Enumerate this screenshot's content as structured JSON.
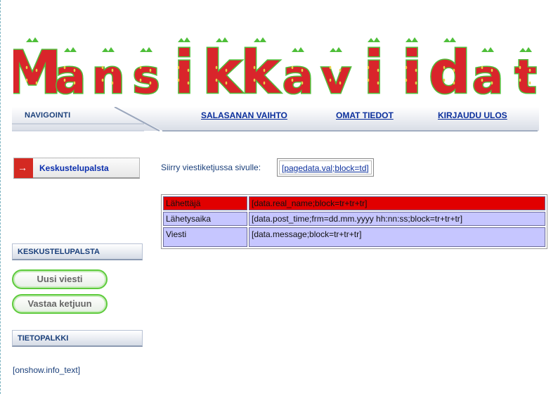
{
  "header": {
    "logo_text": "Mansikkaviidat"
  },
  "nav": {
    "title": "NAVIGOINTI",
    "links": [
      {
        "label": "SALASANAN VAIHTO"
      },
      {
        "label": "OMAT TIEDOT"
      },
      {
        "label": "KIRJAUDU ULOS"
      }
    ]
  },
  "sidebar": {
    "forum_button": "Keskustelupalsta",
    "section1_title": "KESKUSTELUPALSTA",
    "new_message_button": "Uusi viesti",
    "reply_button": "Vastaa ketjuun",
    "section2_title": "TIETOPALKKI",
    "info_text": "[onshow.info_text]"
  },
  "main": {
    "page_nav_label": "Siirry viestiketjussa sivulle:",
    "page_nav_link": "[pagedata.val;block=td]",
    "table": [
      {
        "label": "Lähettäjä",
        "value": "[data.real_name;block=tr+tr+tr]"
      },
      {
        "label": "Lähetysaika",
        "value": "[data.post_time;frm=dd.mm.yyyy hh:nn:ss;block=tr+tr+tr]"
      },
      {
        "label": "Viesti",
        "value": "[data.message;block=tr+tr+tr]"
      }
    ]
  },
  "colors": {
    "strawberry": "#d9252b",
    "leaf": "#4fbf3a",
    "header_row": "#e10000",
    "data_row": "#c6c6ff",
    "link": "#0b2f9c"
  }
}
